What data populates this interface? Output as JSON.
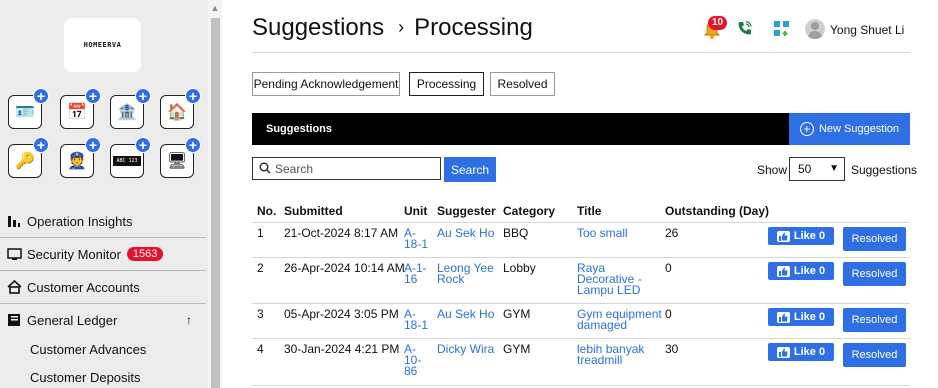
{
  "brand": {
    "logo_text": "HOMEERVA"
  },
  "sidebar": {
    "apps": [
      {
        "name": "visitor-app-icon",
        "glyph": "🪪"
      },
      {
        "name": "calendar-app-icon",
        "glyph": "📅"
      },
      {
        "name": "bank-app-icon",
        "glyph": "🏦"
      },
      {
        "name": "home-tools-app-icon",
        "glyph": "🏠"
      },
      {
        "name": "key-card-app-icon",
        "glyph": "🔑"
      },
      {
        "name": "guard-app-icon",
        "glyph": "👮"
      },
      {
        "name": "car-plate-app-icon",
        "glyph": "🚗"
      },
      {
        "name": "web-login-app-icon",
        "glyph": "🖥"
      }
    ],
    "car_plate_text": "ABC 123",
    "items": [
      {
        "label": "Operation Insights"
      },
      {
        "label": "Security Monitor",
        "badge": "1563"
      },
      {
        "label": "Customer Accounts"
      },
      {
        "label": "General Ledger"
      }
    ],
    "sub_items": [
      {
        "label": "Customer Advances"
      },
      {
        "label": "Customer Deposits"
      }
    ]
  },
  "header": {
    "breadcrumb": [
      "Suggestions",
      "Processing"
    ],
    "separator": "›",
    "notification_count": "10",
    "user_name": "Yong Shuet Li"
  },
  "tabs": [
    {
      "label": "Pending Acknowledgement",
      "active": false
    },
    {
      "label": "Processing",
      "active": true
    },
    {
      "label": "Resolved",
      "active": false
    }
  ],
  "section": {
    "title": "Suggestions",
    "new_button": "New Suggestion"
  },
  "search": {
    "placeholder": "Search",
    "button": "Search"
  },
  "paging": {
    "show_label": "Show",
    "value": "50",
    "suffix": "Suggestions"
  },
  "table": {
    "columns": [
      "No.",
      "Submitted",
      "Unit",
      "Suggester",
      "Category",
      "Title",
      "Outstanding (Day)"
    ],
    "rows": [
      {
        "no": "1",
        "submitted": "21-Oct-2024 8:17 AM",
        "unit": [
          "A-",
          "18-1"
        ],
        "suggester": [
          "Au Sek Ho"
        ],
        "category": "BBQ",
        "title": [
          "Too small"
        ],
        "outstanding": "26",
        "like": "Like 0",
        "action": "Resolved"
      },
      {
        "no": "2",
        "submitted": "26-Apr-2024 10:14 AM",
        "unit": [
          "A-1-",
          "16"
        ],
        "suggester": [
          "Leong Yee",
          "Rock"
        ],
        "category": "Lobby",
        "title": [
          "Raya",
          "Decorative -",
          "Lampu LED"
        ],
        "outstanding": "0",
        "like": "Like 0",
        "action": "Resolved"
      },
      {
        "no": "3",
        "submitted": "05-Apr-2024 3:05 PM",
        "unit": [
          "A-",
          "18-1"
        ],
        "suggester": [
          "Au Sek Ho"
        ],
        "category": "GYM",
        "title": [
          "Gym equipment",
          "damaged"
        ],
        "outstanding": "0",
        "like": "Like 0",
        "action": "Resolved"
      },
      {
        "no": "4",
        "submitted": "30-Jan-2024 4:21 PM",
        "unit": [
          "A-",
          "10-",
          "86"
        ],
        "suggester": [
          "Dicky Wira"
        ],
        "category": "GYM",
        "title": [
          "lebih banyak",
          "treadmill"
        ],
        "outstanding": "30",
        "like": "Like 0",
        "action": "Resolved"
      }
    ]
  },
  "colors": {
    "accent": "#2f6fe4",
    "badge": "#e4122a",
    "bar": "#000000"
  }
}
